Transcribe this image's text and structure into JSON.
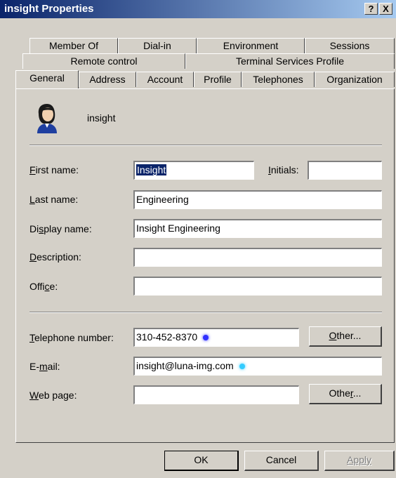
{
  "window": {
    "title": "insight Properties",
    "help_label": "?",
    "close_label": "X"
  },
  "tabs": {
    "row1": [
      "Member Of",
      "Dial-in",
      "Environment",
      "Sessions"
    ],
    "row2": [
      "Remote control",
      "Terminal Services Profile"
    ],
    "row3": [
      "General",
      "Address",
      "Account",
      "Profile",
      "Telephones",
      "Organization"
    ]
  },
  "general": {
    "user_name": "insight",
    "first_name": {
      "label": "First name:",
      "value": "Insight"
    },
    "initials": {
      "label": "Initials:",
      "value": ""
    },
    "last_name": {
      "label": "Last name:",
      "value": "Engineering"
    },
    "display_name": {
      "label": "Display name:",
      "value": "Insight Engineering"
    },
    "description": {
      "label": "Description:",
      "value": ""
    },
    "office": {
      "label": "Office:",
      "value": ""
    },
    "telephone": {
      "label": "Telephone number:",
      "value": "310-452-8370"
    },
    "email": {
      "label": "E-mail:",
      "value": "insight@luna-img.com"
    },
    "web_page": {
      "label": "Web page:",
      "value": ""
    },
    "other_label": "Other..."
  },
  "footer": {
    "ok": "OK",
    "cancel": "Cancel",
    "apply": "Apply"
  },
  "colors": {
    "title_start": "#0a246a",
    "title_end": "#a6caf0",
    "dialog_bg": "#d4d0c8",
    "dot_blue": "#3030ff",
    "dot_cyan": "#33ccff"
  }
}
